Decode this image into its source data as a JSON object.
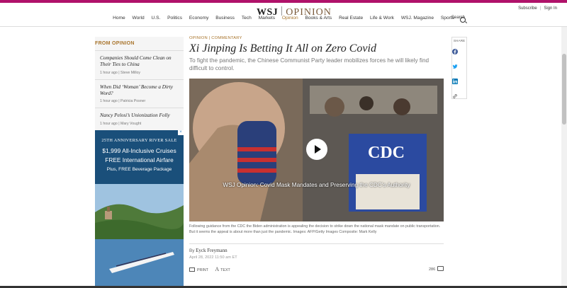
{
  "header": {
    "logo_main": "WSJ",
    "logo_section": "OPINION",
    "subscribe": "Subscribe",
    "sign_in": "Sign In",
    "search_label": "Search"
  },
  "nav": {
    "items": [
      "Home",
      "World",
      "U.S.",
      "Politics",
      "Economy",
      "Business",
      "Tech",
      "Markets",
      "Opinion",
      "Books & Arts",
      "Real Estate",
      "Life & Work",
      "WSJ. Magazine",
      "Sports"
    ],
    "active": "Opinion"
  },
  "sidebar": {
    "heading": "FROM OPINION",
    "items": [
      {
        "title": "Companies Should Come Clean on Their Ties to China",
        "time": "1 hour ago",
        "author": "Steve Milloy"
      },
      {
        "title": "When Did ‘Woman’ Become a Dirty Word?",
        "time": "1 hour ago",
        "author": "Patricia Posner"
      },
      {
        "title": "Nancy Pelosi’s Unionization Folly",
        "time": "1 hour ago",
        "author": "Mary Vought"
      }
    ]
  },
  "ad": {
    "line1": "25TH ANNIVERSARY RIVER SALE",
    "line2": "$1,999 All-Inclusive Cruises",
    "line3": "FREE International Airfare",
    "line4": "Plus, FREE Beverage Package",
    "close": "×"
  },
  "article": {
    "kicker_section": "OPINION",
    "kicker_type": "COMMENTARY",
    "headline": "Xi Jinping Is Betting It All on Zero Covid",
    "dek": "To fight the pandemic, the Chinese Communist Party leader mobilizes forces he will likely find difficult to control.",
    "video_title": "WSJ Opinion: Covid Mask Mandates and Preserving the CDC's Authority",
    "video_badge": "CDC",
    "caption": "Following guidance from the CDC the Biden administration is appealing the decision to strike down the national mask mandate on public transportation. But it seems the appeal is about more than just the pandemic. Images: AFP/Getty Images Composite: Mark Kelly",
    "byline_prefix": "By",
    "author": "Eyck Freymann",
    "date": "April 28, 2022 11:50 am ET",
    "print_label": "PRINT",
    "text_label": "TEXT",
    "comment_count": "286"
  },
  "share": {
    "label": "SHARE",
    "colors": {
      "facebook": "#3b5998",
      "twitter": "#1da1f2",
      "linkedin": "#0077b5"
    }
  }
}
